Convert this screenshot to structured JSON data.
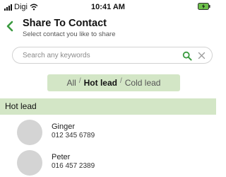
{
  "status_bar": {
    "carrier": "Digi",
    "time": "10:41 AM",
    "signal_icon": "signal-bars-icon",
    "wifi_icon": "wifi-icon",
    "battery_icon": "battery-charging-icon"
  },
  "header": {
    "back_icon": "chevron-left-icon",
    "title": "Share To Contact",
    "subtitle": "Select contact you like to share"
  },
  "search": {
    "placeholder": "Search any keywords",
    "value": "",
    "search_icon": "search-icon",
    "clear_icon": "close-icon"
  },
  "filter": {
    "options": [
      {
        "label": "All",
        "active": false
      },
      {
        "label": "Hot lead",
        "active": true
      },
      {
        "label": "Cold lead",
        "active": false
      }
    ],
    "separator": "/"
  },
  "section": {
    "title": "Hot lead"
  },
  "contacts": [
    {
      "name": "Ginger",
      "phone": "012 345 6789"
    },
    {
      "name": "Peter",
      "phone": "016 457 2389"
    }
  ],
  "colors": {
    "accent_green": "#3a9a3f",
    "highlight_bg": "#d3e6c6",
    "avatar_placeholder": "#d4d4d4"
  }
}
